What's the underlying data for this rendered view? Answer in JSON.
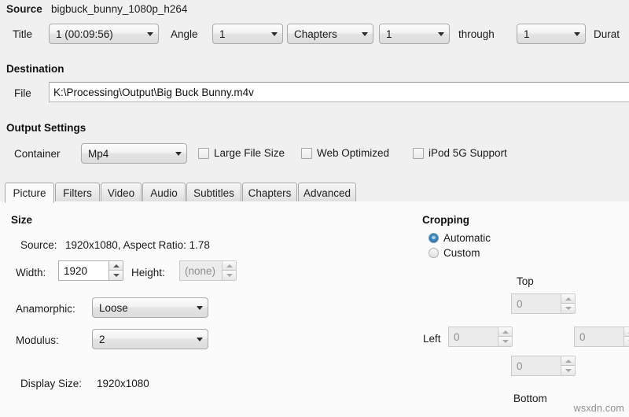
{
  "source": {
    "label": "Source",
    "filename": "bigbuck_bunny_1080p_h264",
    "title_label": "Title",
    "title_value": "1 (00:09:56)",
    "angle_label": "Angle",
    "angle_value": "1",
    "range_type_value": "Chapters",
    "range_start_value": "1",
    "through_label": "through",
    "range_end_value": "1",
    "duration_label": "Durat"
  },
  "destination": {
    "group_label": "Destination",
    "file_label": "File",
    "file_value": "K:\\Processing\\Output\\Big Buck Bunny.m4v"
  },
  "output_settings": {
    "group_label": "Output Settings",
    "container_label": "Container",
    "container_value": "Mp4",
    "large_file_size_label": "Large File Size",
    "large_file_size_checked": false,
    "web_optimized_label": "Web Optimized",
    "web_optimized_checked": false,
    "ipod_5g_label": "iPod 5G Support",
    "ipod_5g_checked": false
  },
  "tabs": [
    {
      "label": "Picture",
      "active": true
    },
    {
      "label": "Filters",
      "active": false
    },
    {
      "label": "Video",
      "active": false
    },
    {
      "label": "Audio",
      "active": false
    },
    {
      "label": "Subtitles",
      "active": false
    },
    {
      "label": "Chapters",
      "active": false
    },
    {
      "label": "Advanced",
      "active": false
    }
  ],
  "picture": {
    "size": {
      "group_label": "Size",
      "source_label": "Source:",
      "source_value": "1920x1080, Aspect Ratio: 1.78",
      "width_label": "Width:",
      "width_value": "1920",
      "height_label": "Height:",
      "height_placeholder": "(none)",
      "anamorphic_label": "Anamorphic:",
      "anamorphic_value": "Loose",
      "modulus_label": "Modulus:",
      "modulus_value": "2",
      "display_size_label": "Display Size:",
      "display_size_value": "1920x1080"
    },
    "cropping": {
      "group_label": "Cropping",
      "automatic_label": "Automatic",
      "custom_label": "Custom",
      "selected": "Automatic",
      "top_label": "Top",
      "top_value": "0",
      "left_label": "Left",
      "left_value": "0",
      "right_value": "0",
      "bottom_label": "Bottom",
      "bottom_value": "0"
    }
  },
  "watermark": "wsxdn.com",
  "colors": {
    "window_bg": "#f0f0f0",
    "panel_bg": "#fbfbfb",
    "radio_accent": "#2f7fb5",
    "border": "#a8a8a8"
  }
}
